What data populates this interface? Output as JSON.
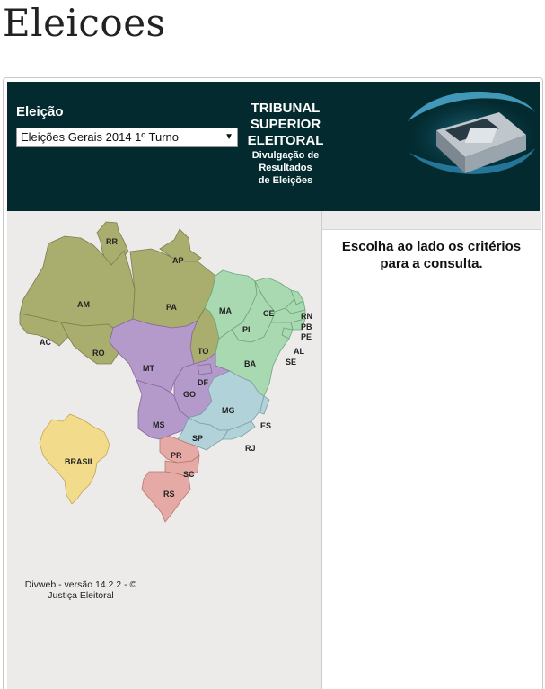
{
  "page": {
    "title": "Eleicoes"
  },
  "header": {
    "election_label": "Eleição",
    "election_select_value": "Eleições Gerais 2014 1º Turno",
    "select_arrow": "▼",
    "tse_line1": "TRIBUNAL",
    "tse_line2": "SUPERIOR",
    "tse_line3": "ELEITORAL",
    "tse_sub1": "Divulgação de",
    "tse_sub2": "Resultados",
    "tse_sub3": "de Eleições"
  },
  "map": {
    "states": [
      "RR",
      "AP",
      "AM",
      "PA",
      "MA",
      "CE",
      "RN",
      "PB",
      "PE",
      "PI",
      "AC",
      "RO",
      "TO",
      "AL",
      "SE",
      "MT",
      "BA",
      "DF",
      "GO",
      "MG",
      "MS",
      "ES",
      "SP",
      "RJ",
      "PR",
      "SC",
      "RS"
    ],
    "brasil_label": "BRASIL",
    "colors": {
      "north": "#a9ad6e",
      "northeast": "#a8d9b0",
      "center_west": "#b49acb",
      "southeast": "#b0d2d8",
      "south": "#e6aaa6",
      "brasil": "#f2dc8c"
    }
  },
  "content": {
    "prompt_line1": "Escolha ao lado os critérios",
    "prompt_line2": "para a consulta."
  },
  "footer": {
    "line1": "Divweb - versão 14.2.2 - ©",
    "line2": "Justiça Eleitoral"
  }
}
